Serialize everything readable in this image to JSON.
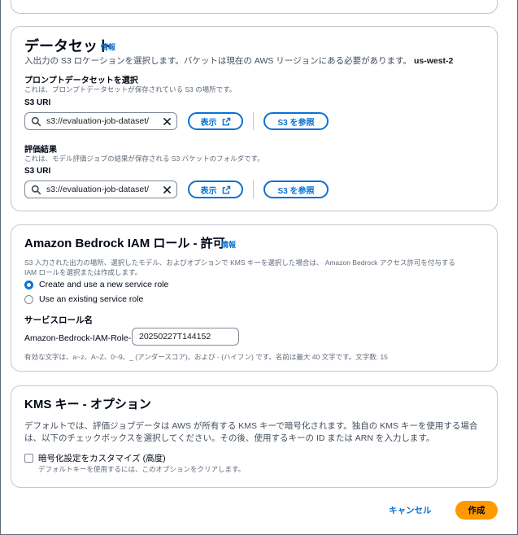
{
  "dataset": {
    "title": "データセット",
    "info": "情報",
    "description_prefix": "入出力の S3 ロケーションを選択します。バケットは現在の AWS リージョンにある必要があります。",
    "region": "us-west-2",
    "prompt_dataset": {
      "label": "プロンプトデータセットを選択",
      "sublabel": "これは、プロンプトデータセットが保存されている S3 の場所です。",
      "uri_label": "S3 URI",
      "uri_value": "s3://evaluation-job-dataset/"
    },
    "results": {
      "label": "評価結果",
      "sublabel": "これは、モデル評価ジョブの結果が保存される S3 バケットのフォルダです。",
      "uri_label": "S3 URI",
      "uri_value": "s3://evaluation-job-dataset/"
    },
    "view_button": "表示",
    "browse_button": "S3 を参照"
  },
  "iam": {
    "title": "Amazon Bedrock IAM ロール - 許可",
    "info": "情報",
    "description_line1": "S3 入力された出力の場所、選択したモデル、およびオプションで KMS キーを選択した場合は、 Amazon Bedrock アクセス許可を付与する",
    "description_line2": "IAM ロールを選択または作成します。",
    "options": [
      {
        "label": "Create and use a new service role",
        "selected": true
      },
      {
        "label": "Use an existing service role",
        "selected": false
      }
    ],
    "service_role_label": "サービスロール名",
    "role_prefix": "Amazon-Bedrock-IAM-Role-",
    "role_value": "20250227T144152",
    "constraint": "有効な文字は、a~z、A~Z、0~9、_ (アンダースコア)、および - (ハイフン) です。名前は最大 40 文字です。文字数: 15"
  },
  "kms": {
    "title": "KMS キー - オプション",
    "description_line1": "デフォルトでは、評価ジョブデータは AWS が所有する KMS キーで暗号化されます。独自の KMS キーを使用する場合",
    "description_line2": "は、以下のチェックボックスを選択してください。その後、使用するキーの ID または ARN を入力します。",
    "checkbox_label": "暗号化設定をカスタマイズ (高度)",
    "checkbox_hint": "デフォルトキーを使用するには、このオプションをクリアします。",
    "checked": false
  },
  "footer": {
    "cancel": "キャンセル",
    "create": "作成"
  },
  "colors": {
    "link": "#0972d3",
    "primary": "#ff9900",
    "border": "#c6c6cd"
  }
}
